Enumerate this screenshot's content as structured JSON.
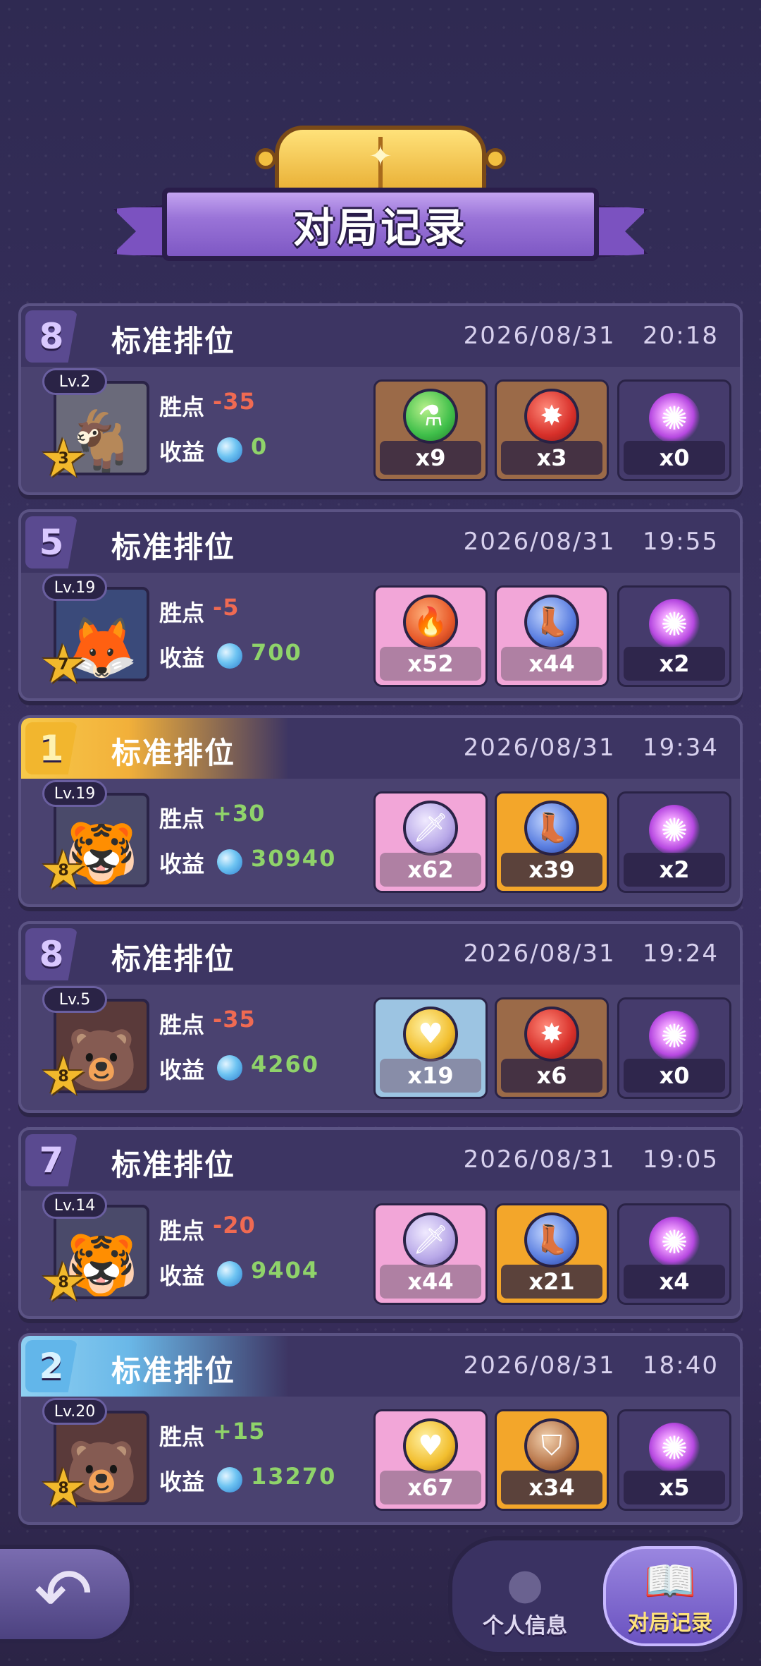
{
  "title": "对局记录",
  "matches": [
    {
      "rank": "8",
      "rank_color": "#d9c8ff",
      "highlight": "",
      "mode": "标准排位",
      "date": "2026/08/31   20:18",
      "level": "Lv.2",
      "stars": "3",
      "avatar_icon": "goat-girl-avatar-icon",
      "avatar_glyph": "🐐",
      "avatar_bg": "#6a6a7a",
      "points_label": "胜点",
      "points": "-35",
      "points_sign": "neg",
      "income_label": "收益",
      "income": "0",
      "items": [
        {
          "icon": "potion-icon",
          "glyph": "⚗",
          "count": "x9",
          "bg": "bg-brown",
          "circle": "c-green"
        },
        {
          "icon": "burst-icon",
          "glyph": "✸",
          "count": "x3",
          "bg": "bg-brown",
          "circle": "c-red"
        },
        {
          "icon": "swirl-icon",
          "glyph": "✺",
          "count": "x0",
          "bg": "bg-dark",
          "circle": "swirl"
        }
      ]
    },
    {
      "rank": "5",
      "rank_color": "#d9c8ff",
      "highlight": "",
      "mode": "标准排位",
      "date": "2026/08/31   19:55",
      "level": "Lv.19",
      "stars": "7",
      "avatar_icon": "fox-avatar-icon",
      "avatar_glyph": "🦊",
      "avatar_bg": "#3a4a7a",
      "points_label": "胜点",
      "points": "-5",
      "points_sign": "neg",
      "income_label": "收益",
      "income": "700",
      "items": [
        {
          "icon": "fire-icon",
          "glyph": "🔥",
          "count": "x52",
          "bg": "bg-pink",
          "circle": "c-orange"
        },
        {
          "icon": "boot-icon",
          "glyph": "👢",
          "count": "x44",
          "bg": "bg-pink",
          "circle": "c-blue"
        },
        {
          "icon": "swirl-icon",
          "glyph": "✺",
          "count": "x2",
          "bg": "bg-dark",
          "circle": "swirl"
        }
      ]
    },
    {
      "rank": "1",
      "rank_color": "#fff2b0",
      "highlight": "gold",
      "mode": "标准排位",
      "date": "2026/08/31   19:34",
      "level": "Lv.19",
      "stars": "8",
      "avatar_icon": "tiger-avatar-icon",
      "avatar_glyph": "🐯",
      "avatar_bg": "#4a4a6a",
      "points_label": "胜点",
      "points": "+30",
      "points_sign": "pos",
      "income_label": "收益",
      "income": "30940",
      "items": [
        {
          "icon": "dagger-icon",
          "glyph": "🗡",
          "count": "x62",
          "bg": "bg-pink",
          "circle": "c-lilac"
        },
        {
          "icon": "boot-icon",
          "glyph": "👢",
          "count": "x39",
          "bg": "bg-orange",
          "circle": "c-blue"
        },
        {
          "icon": "swirl-icon",
          "glyph": "✺",
          "count": "x2",
          "bg": "bg-dark",
          "circle": "swirl"
        }
      ]
    },
    {
      "rank": "8",
      "rank_color": "#d9c8ff",
      "highlight": "",
      "mode": "标准排位",
      "date": "2026/08/31   19:24",
      "level": "Lv.5",
      "stars": "8",
      "avatar_icon": "bear-avatar-icon",
      "avatar_glyph": "🐻",
      "avatar_bg": "#5a3a3a",
      "points_label": "胜点",
      "points": "-35",
      "points_sign": "neg",
      "income_label": "收益",
      "income": "4260",
      "items": [
        {
          "icon": "heart-icon",
          "glyph": "♥",
          "count": "x19",
          "bg": "bg-blue",
          "circle": "c-gold"
        },
        {
          "icon": "burst-icon",
          "glyph": "✸",
          "count": "x6",
          "bg": "bg-brown",
          "circle": "c-red"
        },
        {
          "icon": "swirl-icon",
          "glyph": "✺",
          "count": "x0",
          "bg": "bg-dark",
          "circle": "swirl"
        }
      ]
    },
    {
      "rank": "7",
      "rank_color": "#d9c8ff",
      "highlight": "",
      "mode": "标准排位",
      "date": "2026/08/31   19:05",
      "level": "Lv.14",
      "stars": "8",
      "avatar_icon": "tiger-avatar-icon",
      "avatar_glyph": "🐯",
      "avatar_bg": "#4a4a6a",
      "points_label": "胜点",
      "points": "-20",
      "points_sign": "neg",
      "income_label": "收益",
      "income": "9404",
      "items": [
        {
          "icon": "dagger-icon",
          "glyph": "🗡",
          "count": "x44",
          "bg": "bg-pink",
          "circle": "c-lilac"
        },
        {
          "icon": "boot-icon",
          "glyph": "👢",
          "count": "x21",
          "bg": "bg-orange",
          "circle": "c-blue"
        },
        {
          "icon": "swirl-icon",
          "glyph": "✺",
          "count": "x4",
          "bg": "bg-dark",
          "circle": "swirl"
        }
      ]
    },
    {
      "rank": "2",
      "rank_color": "#d8f2ff",
      "highlight": "blue",
      "mode": "标准排位",
      "date": "2026/08/31   18:40",
      "level": "Lv.20",
      "stars": "8",
      "avatar_icon": "bear-avatar-icon",
      "avatar_glyph": "🐻",
      "avatar_bg": "#5a3a3a",
      "points_label": "胜点",
      "points": "+15",
      "points_sign": "pos",
      "income_label": "收益",
      "income": "13270",
      "items": [
        {
          "icon": "heart-icon",
          "glyph": "♥",
          "count": "x67",
          "bg": "bg-pink",
          "circle": "c-gold"
        },
        {
          "icon": "shield-icon",
          "glyph": "⛉",
          "count": "x34",
          "bg": "bg-orange",
          "circle": "c-bronze"
        },
        {
          "icon": "swirl-icon",
          "glyph": "✺",
          "count": "x5",
          "bg": "bg-dark",
          "circle": "swirl"
        }
      ]
    }
  ],
  "nav": {
    "back_icon": "back-arrow-icon",
    "tabs": [
      {
        "label": "个人信息",
        "icon": "person-icon",
        "active": false
      },
      {
        "label": "对局记录",
        "icon": "book-icon",
        "active": true
      }
    ]
  },
  "colors": {
    "negative": "#f06a52",
    "positive": "#8fd36a",
    "gold_highlight": "#f7c94a",
    "blue_highlight": "#8fd0f2"
  }
}
